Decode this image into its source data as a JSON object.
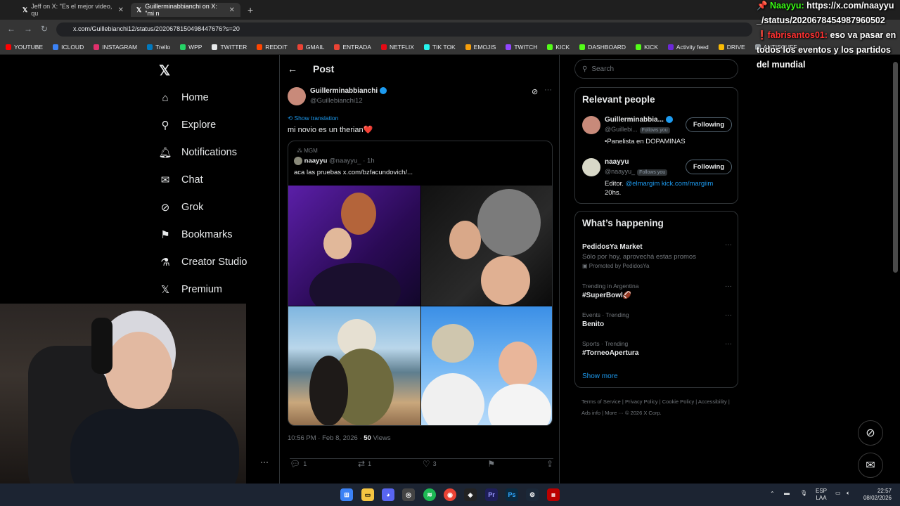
{
  "browser": {
    "tabs": [
      {
        "title": "Jeff on X: \"Es el mejor video, qu"
      },
      {
        "title": "Guillerminabbianchi on X: \"mi n"
      }
    ],
    "url": "x.com/Guillebianchi12/status/2020678150498447676?s=20",
    "bookmarks": [
      {
        "label": "YOUTUBE",
        "color": "#ff0000"
      },
      {
        "label": "ICLOUD",
        "color": "#3b82f6"
      },
      {
        "label": "INSTAGRAM",
        "color": "#e1306c"
      },
      {
        "label": "Trello",
        "color": "#0079bf"
      },
      {
        "label": "WPP",
        "color": "#25d366"
      },
      {
        "label": "TWITTER",
        "color": "#e7e9ea"
      },
      {
        "label": "REDDIT",
        "color": "#ff4500"
      },
      {
        "label": "GMAIL",
        "color": "#ea4335"
      },
      {
        "label": "ENTRADA",
        "color": "#ea4335"
      },
      {
        "label": "NETFLIX",
        "color": "#e50914"
      },
      {
        "label": "TIK TOK",
        "color": "#25f4ee"
      },
      {
        "label": "EMOJIS",
        "color": "#f59e0b"
      },
      {
        "label": "TWITCH",
        "color": "#9146ff"
      },
      {
        "label": "KICK",
        "color": "#53fc18"
      },
      {
        "label": "DASHBOARD",
        "color": "#53fc18"
      },
      {
        "label": "KICK",
        "color": "#53fc18"
      },
      {
        "label": "Activity feed",
        "color": "#6d28d9"
      },
      {
        "label": "DRIVE",
        "color": "#fbbc04"
      },
      {
        "label": "ANTISCUFF",
        "color": "#9aa0a6"
      }
    ]
  },
  "sidenav": {
    "items": [
      {
        "label": "Home",
        "icon": "home-icon"
      },
      {
        "label": "Explore",
        "icon": "search-icon"
      },
      {
        "label": "Notifications",
        "icon": "bell-icon"
      },
      {
        "label": "Chat",
        "icon": "mail-icon"
      },
      {
        "label": "Grok",
        "icon": "grok-icon"
      },
      {
        "label": "Bookmarks",
        "icon": "bookmark-icon"
      },
      {
        "label": "Creator Studio",
        "icon": "flask-icon"
      },
      {
        "label": "Premium",
        "icon": "x-logo-icon"
      }
    ],
    "more": "···"
  },
  "post": {
    "header": "Post",
    "author_name": "Guillerminabbianchi",
    "author_handle": "@Guillebianchi12",
    "show_translation": "Show translation",
    "text": "mi novio es un therian❤️",
    "quote": {
      "community": "MGM",
      "author_name": "naayyu",
      "author_handle": "@naayyu_ · 1h",
      "text": "aca las pruebas  x.com/bzfacundovich/..."
    },
    "meta_time": "10:56 PM · Feb 8, 2026 · ",
    "views_count": "50",
    "views_label": " Views",
    "actions": {
      "replies": "1",
      "reposts": "1",
      "likes": "3"
    }
  },
  "sidebar": {
    "search_placeholder": "Search",
    "relevant_title": "Relevant people",
    "people": [
      {
        "name": "Guillerminabbia...",
        "handle": "@Guillebi...",
        "badge": "Follows you",
        "bio": "•Panelista en DOPAMINAS",
        "button": "Following"
      },
      {
        "name": "naayyu",
        "handle": "@naayyu_",
        "badge": "Follows you",
        "bio_prefix": "Editor. ",
        "bio_link": "@elmargim kick.com/margiim",
        "bio_suffix": "20hs.",
        "button": "Following"
      }
    ],
    "happening_title": "What’s happening",
    "trends": [
      {
        "context": "",
        "title": "PedidosYa Market",
        "desc": "Sólo por hoy, aprovechá estas promos",
        "promo": "Promoted by PedidosYa"
      },
      {
        "context": "Trending in Argentina",
        "title": "#SuperBowl🏈"
      },
      {
        "context": "Events · Trending",
        "title": "Benito"
      },
      {
        "context": "Sports · Trending",
        "title": "#TorneoApertura"
      }
    ],
    "show_more": "Show more",
    "footer": "Terms of Service  |  Privacy Policy  |  Cookie Policy  |  Accessibility  |  Ads info  |  More ···  © 2026 X Corp."
  },
  "overlay_chat": {
    "user1": "Naayyu:",
    "message1": "https://x.com/naayyu_/status/2020678454987960502",
    "user2": "fabrisantos01:",
    "message2": "eso va pasar en todos los eventos y los partidos del mundial"
  },
  "taskbar": {
    "lang": "ESP",
    "lang2": "LAA",
    "time": "22:57",
    "date": "08/02/2026"
  }
}
